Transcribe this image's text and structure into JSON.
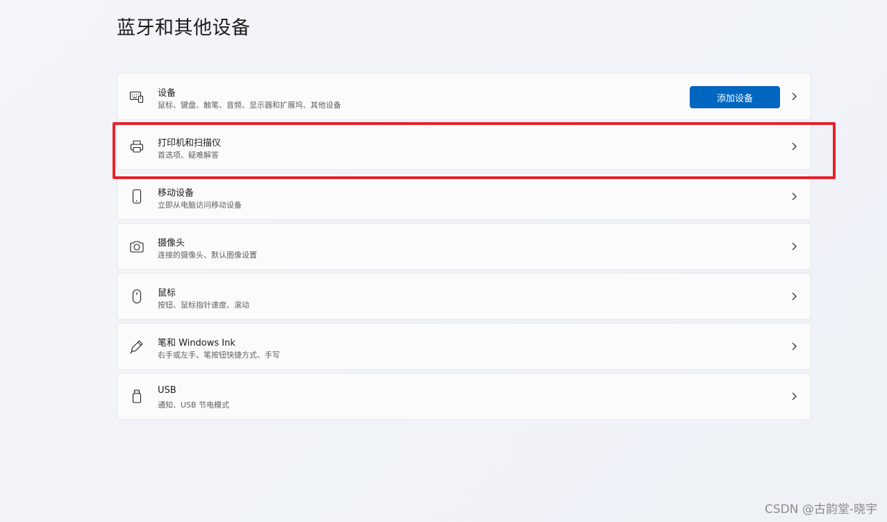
{
  "page": {
    "title": "蓝牙和其他设备"
  },
  "cards": [
    {
      "icon": "keyboard-icon",
      "title": "设备",
      "subtitle": "鼠标、键盘、触笔、音频、显示器和扩展坞、其他设备",
      "button_label": "添加设备"
    },
    {
      "icon": "printer-icon",
      "title": "打印机和扫描仪",
      "subtitle": "首选项、疑难解答",
      "highlighted": true
    },
    {
      "icon": "phone-icon",
      "title": "移动设备",
      "subtitle": "立即从电脑访问移动设备"
    },
    {
      "icon": "camera-icon",
      "title": "摄像头",
      "subtitle": "连接的摄像头、默认图像设置"
    },
    {
      "icon": "mouse-icon",
      "title": "鼠标",
      "subtitle": "按钮、鼠标指针速度、滚动"
    },
    {
      "icon": "pen-icon",
      "title": "笔和 Windows Ink",
      "subtitle": "右手或左手、笔按钮快捷方式、手写"
    },
    {
      "icon": "usb-icon",
      "title": "USB",
      "subtitle": "通知、USB 节电模式"
    }
  ],
  "colors": {
    "accent": "#0067c0",
    "highlight": "#e8202a"
  },
  "watermark": "CSDN @古韵堂-晓宇"
}
